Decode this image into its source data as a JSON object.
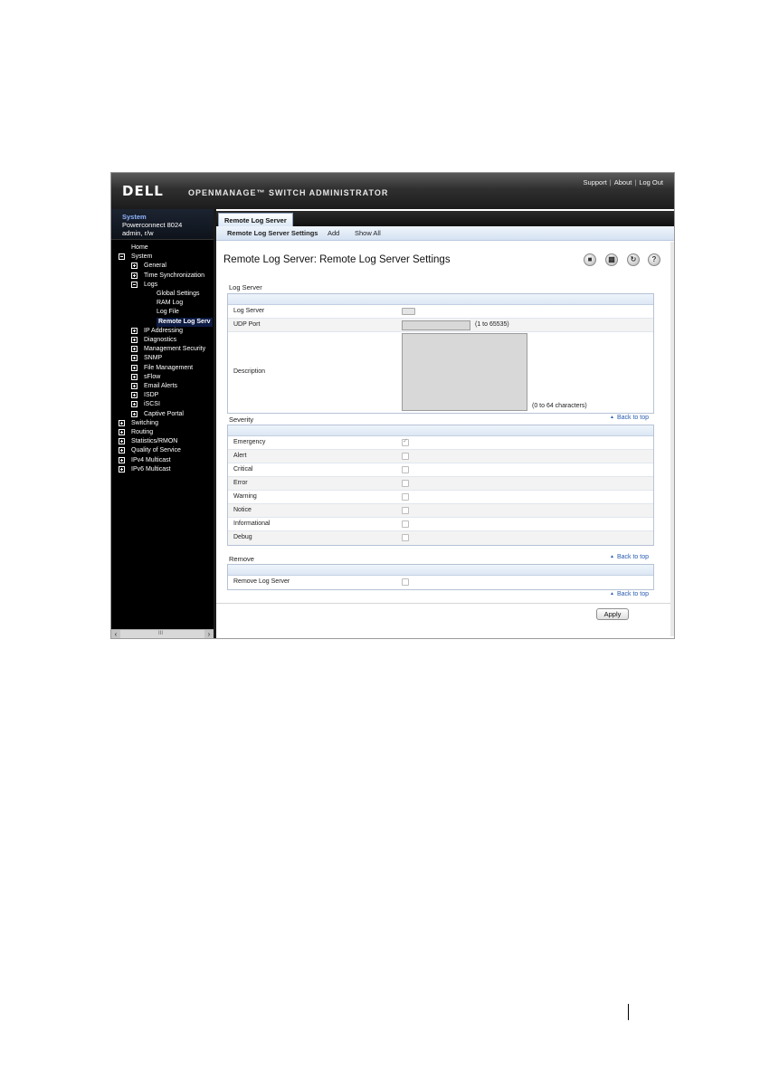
{
  "header": {
    "logo": "DELL",
    "product": "OPENMANAGE™ SWITCH ADMINISTRATOR",
    "links": [
      "Support",
      "About",
      "Log Out"
    ]
  },
  "system_info": {
    "title": "System",
    "model": "Powerconnect 8024",
    "user": "admin, r/w"
  },
  "nav_tree": [
    {
      "label": "Home",
      "level": 0,
      "expander": "none",
      "selected": false
    },
    {
      "label": "System",
      "level": 0,
      "expander": "minus",
      "selected": false
    },
    {
      "label": "General",
      "level": 1,
      "expander": "plus",
      "selected": false
    },
    {
      "label": "Time Synchronization",
      "level": 1,
      "expander": "plus",
      "selected": false
    },
    {
      "label": "Logs",
      "level": 1,
      "expander": "minus",
      "selected": false
    },
    {
      "label": "Global Settings",
      "level": 2,
      "expander": "none",
      "selected": false
    },
    {
      "label": "RAM Log",
      "level": 2,
      "expander": "none",
      "selected": false
    },
    {
      "label": "Log File",
      "level": 2,
      "expander": "none",
      "selected": false
    },
    {
      "label": "Remote Log Serv",
      "level": 2,
      "expander": "none",
      "selected": true
    },
    {
      "label": "IP Addressing",
      "level": 1,
      "expander": "plus",
      "selected": false
    },
    {
      "label": "Diagnostics",
      "level": 1,
      "expander": "plus",
      "selected": false
    },
    {
      "label": "Management Security",
      "level": 1,
      "expander": "plus",
      "selected": false
    },
    {
      "label": "SNMP",
      "level": 1,
      "expander": "plus",
      "selected": false
    },
    {
      "label": "File Management",
      "level": 1,
      "expander": "plus",
      "selected": false
    },
    {
      "label": "sFlow",
      "level": 1,
      "expander": "plus",
      "selected": false
    },
    {
      "label": "Email Alerts",
      "level": 1,
      "expander": "plus",
      "selected": false
    },
    {
      "label": "ISDP",
      "level": 1,
      "expander": "plus",
      "selected": false
    },
    {
      "label": "iSCSI",
      "level": 1,
      "expander": "plus",
      "selected": false
    },
    {
      "label": "Captive Portal",
      "level": 1,
      "expander": "plus",
      "selected": false
    },
    {
      "label": "Switching",
      "level": 0,
      "expander": "plus",
      "selected": false
    },
    {
      "label": "Routing",
      "level": 0,
      "expander": "plus",
      "selected": false
    },
    {
      "label": "Statistics/RMON",
      "level": 0,
      "expander": "plus",
      "selected": false
    },
    {
      "label": "Quality of Service",
      "level": 0,
      "expander": "plus",
      "selected": false
    },
    {
      "label": "IPv4 Multicast",
      "level": 0,
      "expander": "plus",
      "selected": false
    },
    {
      "label": "IPv6 Multicast",
      "level": 0,
      "expander": "plus",
      "selected": false
    }
  ],
  "tabs": {
    "main": "Remote Log Server",
    "sub": [
      "Remote Log Server Settings",
      "Add",
      "Show All"
    ],
    "active_sub": "Remote Log Server Settings"
  },
  "page": {
    "title": "Remote Log Server: Remote Log Server Settings",
    "toolbar_icons": [
      "save-icon",
      "print-icon",
      "refresh-icon",
      "help-icon"
    ]
  },
  "log_server_section": {
    "title": "Log Server",
    "log_server_label": "Log Server",
    "udp_port_label": "UDP Port",
    "udp_port_value": "",
    "udp_port_range": "(1 to 65535)",
    "description_label": "Description",
    "description_value": "",
    "description_hint": "(0 to 64 characters)"
  },
  "severity_section": {
    "title": "Severity",
    "back_to_top": "Back to top",
    "levels": [
      {
        "label": "Emergency",
        "checked": true
      },
      {
        "label": "Alert",
        "checked": false
      },
      {
        "label": "Critical",
        "checked": false
      },
      {
        "label": "Error",
        "checked": false
      },
      {
        "label": "Warning",
        "checked": false
      },
      {
        "label": "Notice",
        "checked": false
      },
      {
        "label": "Informational",
        "checked": false
      },
      {
        "label": "Debug",
        "checked": false
      }
    ]
  },
  "remove_section": {
    "title": "Remove",
    "back_to_top": "Back to top",
    "remove_label": "Remove Log Server",
    "remove_checked": false,
    "back_to_top_bottom": "Back to top"
  },
  "apply_label": "Apply",
  "scrollbar_mid": "III"
}
